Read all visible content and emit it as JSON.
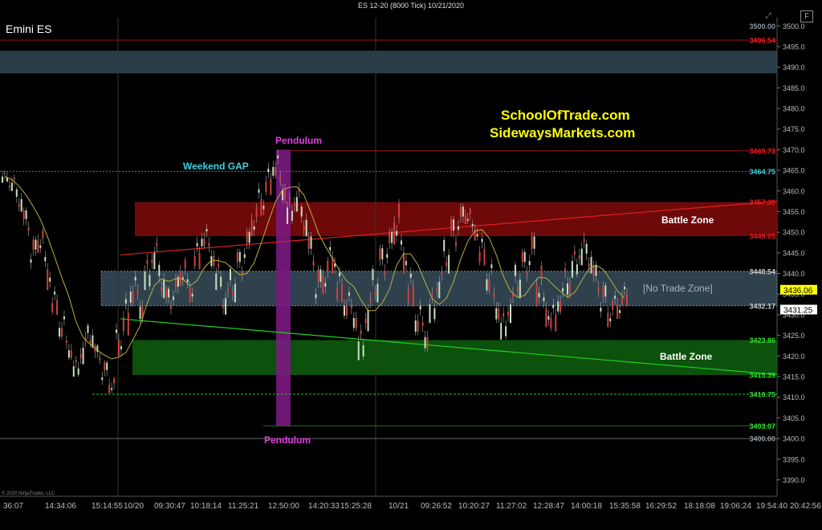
{
  "window": {
    "title": "ES 12-20 (8000 Tick)  10/21/2020",
    "f_button": "F",
    "expand_icon": "expand-icon"
  },
  "chart_header": {
    "instrument": "Emini ES"
  },
  "copyright": "© 2020 NinjaTrader, LLC",
  "branding": {
    "line1": "SchoolOfTrade.com",
    "line2": "SidewaysMarkets.com",
    "color": "#ffff00"
  },
  "colors": {
    "background": "#000000",
    "resistance": "#d01010",
    "support": "#10c010",
    "no_trade": "#5a7080",
    "pendulum": "#8b1e8b",
    "gap": "#40d0e0"
  },
  "chart_data": {
    "type": "candlestick",
    "ylim": [
      3386,
      3502
    ],
    "y_ticks": [
      3390,
      3395,
      3400,
      3405,
      3410,
      3415,
      3420,
      3425,
      3430,
      3435,
      3440,
      3445,
      3450,
      3455,
      3460,
      3465,
      3470,
      3475,
      3480,
      3485,
      3490,
      3495,
      3500
    ],
    "x_tick_labels": [
      "36:07",
      "14:34:06",
      "15:14:55",
      "10/20",
      "09:30:47",
      "10:18:14",
      "11:25:21",
      "12:50:00",
      "14:20:33",
      "15:25:28",
      "10/21",
      "09:26:52",
      "10:20:27",
      "11:27:02",
      "12:28:47",
      "14:00:18",
      "15:35:58",
      "16:29:52",
      "18:18:08",
      "19:06:24",
      "19:54:40",
      "20:42:56"
    ],
    "price_markers": [
      {
        "price": 3500.0,
        "label": "3500.00",
        "color": "#8a96a0"
      },
      {
        "price": 3496.54,
        "label": "3496.54",
        "color": "#e02020"
      },
      {
        "price": 3469.73,
        "label": "3469.73",
        "color": "#e02020"
      },
      {
        "price": 3464.75,
        "label": "3464.75",
        "color": "#40d0e0"
      },
      {
        "price": 3457.3,
        "label": "3457.30",
        "color": "#e02020"
      },
      {
        "price": 3449.05,
        "label": "3449.05",
        "color": "#e02020"
      },
      {
        "price": 3440.54,
        "label": "3440.54",
        "color": "#cccccc"
      },
      {
        "price": 3432.17,
        "label": "3432.17",
        "color": "#cccccc"
      },
      {
        "price": 3423.86,
        "label": "3423.86",
        "color": "#30e030"
      },
      {
        "price": 3415.39,
        "label": "3415.39",
        "color": "#30e030"
      },
      {
        "price": 3410.75,
        "label": "3410.75",
        "color": "#30e030"
      },
      {
        "price": 3403.07,
        "label": "3403.07",
        "color": "#30e030"
      },
      {
        "price": 3400.0,
        "label": "3400.00",
        "color": "#8a96a0"
      }
    ],
    "current_price_badges": [
      {
        "price": 3436.06,
        "label": "3436.06",
        "bg": "#ffff00",
        "fg": "#000000"
      },
      {
        "price": 3431.25,
        "label": "3431.25",
        "bg": "#ffffff",
        "fg": "#000000"
      }
    ],
    "zones": [
      {
        "name": "top",
        "y_top": 3494,
        "y_bottom": 3488.5,
        "color": "#2e4250",
        "label": ""
      },
      {
        "name": "resistance",
        "y_top": 3457.3,
        "y_bottom": 3449.05,
        "color": "#7a0a0a",
        "label": "Battle Zone"
      },
      {
        "name": "no-trade",
        "y_top": 3440.54,
        "y_bottom": 3432.17,
        "color": "#344855",
        "label": "[No Trade Zone]"
      },
      {
        "name": "support",
        "y_top": 3423.86,
        "y_bottom": 3415.39,
        "color": "#0d5a0d",
        "label": "Battle Zone"
      }
    ],
    "annotations": {
      "weekend_gap": "Weekend GAP",
      "pendulum_top": "Pendulum",
      "pendulum_bottom": "Pendulum"
    },
    "candle_path_points": [
      [
        3462,
        3465
      ],
      [
        3460,
        3464
      ],
      [
        3455,
        3461
      ],
      [
        3449,
        3456
      ],
      [
        3441,
        3449
      ],
      [
        3445,
        3451
      ],
      [
        3436,
        3446
      ],
      [
        3430,
        3437
      ],
      [
        3424,
        3431
      ],
      [
        3419,
        3425
      ],
      [
        3415,
        3420
      ],
      [
        3418,
        3426
      ],
      [
        3422,
        3428
      ],
      [
        3418,
        3423
      ],
      [
        3413,
        3419
      ],
      [
        3411,
        3415
      ],
      [
        3420,
        3428
      ],
      [
        3425,
        3436
      ],
      [
        3432,
        3441
      ],
      [
        3428,
        3438
      ],
      [
        3436,
        3445
      ],
      [
        3441,
        3449
      ],
      [
        3434,
        3443
      ],
      [
        3430,
        3437
      ],
      [
        3432,
        3440
      ],
      [
        3437,
        3444
      ],
      [
        3433,
        3440
      ],
      [
        3441,
        3449
      ],
      [
        3446,
        3452
      ],
      [
        3441,
        3449
      ],
      [
        3436,
        3444
      ],
      [
        3430,
        3438
      ],
      [
        3433,
        3442
      ],
      [
        3438,
        3446
      ],
      [
        3442,
        3451
      ],
      [
        3449,
        3457
      ],
      [
        3454,
        3462
      ],
      [
        3459,
        3467
      ],
      [
        3463,
        3470
      ],
      [
        3457,
        3465
      ],
      [
        3452,
        3460
      ],
      [
        3455,
        3462
      ],
      [
        3449,
        3457
      ],
      [
        3440,
        3450
      ],
      [
        3432,
        3442
      ],
      [
        3435,
        3444
      ],
      [
        3440,
        3448
      ],
      [
        3433,
        3442
      ],
      [
        3429,
        3437
      ],
      [
        3426,
        3434
      ],
      [
        3419,
        3428
      ],
      [
        3426,
        3436
      ],
      [
        3433,
        3442
      ],
      [
        3438,
        3447
      ],
      [
        3442,
        3451
      ],
      [
        3447,
        3458
      ],
      [
        3440,
        3450
      ],
      [
        3432,
        3442
      ],
      [
        3425,
        3434
      ],
      [
        3421,
        3430
      ],
      [
        3428,
        3437
      ],
      [
        3434,
        3442
      ],
      [
        3440,
        3449
      ],
      [
        3445,
        3454
      ],
      [
        3449,
        3457
      ],
      [
        3452,
        3456
      ],
      [
        3448,
        3453
      ],
      [
        3442,
        3450
      ],
      [
        3435,
        3444
      ],
      [
        3428,
        3437
      ],
      [
        3424,
        3432
      ],
      [
        3428,
        3437
      ],
      [
        3434,
        3443
      ],
      [
        3438,
        3446
      ],
      [
        3440,
        3450
      ],
      [
        3432,
        3443
      ],
      [
        3427,
        3436
      ],
      [
        3426,
        3434
      ],
      [
        3430,
        3438
      ],
      [
        3434,
        3443
      ],
      [
        3439,
        3447
      ],
      [
        3442,
        3450
      ],
      [
        3440,
        3448
      ],
      [
        3434,
        3443
      ],
      [
        3429,
        3438
      ],
      [
        3427,
        3434
      ],
      [
        3429,
        3436
      ],
      [
        3432,
        3438
      ]
    ]
  }
}
